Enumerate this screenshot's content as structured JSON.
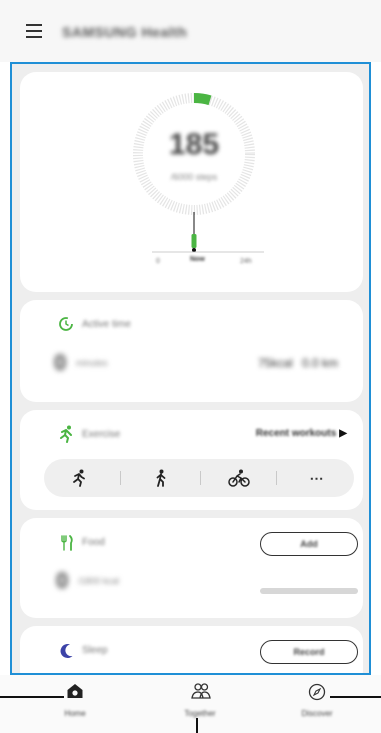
{
  "app": {
    "title": "SAMSUNG Health"
  },
  "steps": {
    "value": "185",
    "unit": "/6000 steps",
    "axis_left": "0",
    "axis_mid": "Now",
    "axis_right": "24h"
  },
  "active_time": {
    "label": "Active time",
    "value": "0",
    "value_unit": "minutes",
    "distance": "75kcal",
    "distance2": "0.0 km"
  },
  "exercise": {
    "label": "Exercise",
    "recent_link": "Recent workouts",
    "recent_arrow": "▶",
    "types": [
      "running-icon",
      "walking-icon",
      "cycling-icon"
    ],
    "more": "⋯"
  },
  "food": {
    "label": "Food",
    "button": "Add",
    "value": "0",
    "value_unit": "/1800 kcal"
  },
  "sleep": {
    "label": "Sleep",
    "button": "Record"
  },
  "nav": {
    "items": [
      {
        "label": "Home",
        "icon": "home-icon"
      },
      {
        "label": "Together",
        "icon": "together-icon"
      },
      {
        "label": "Discover",
        "icon": "compass-icon"
      }
    ]
  },
  "colors": {
    "accent_green": "#4bb543",
    "highlight_blue": "#1f8fd6",
    "sleep_blue": "#3c43a8"
  }
}
